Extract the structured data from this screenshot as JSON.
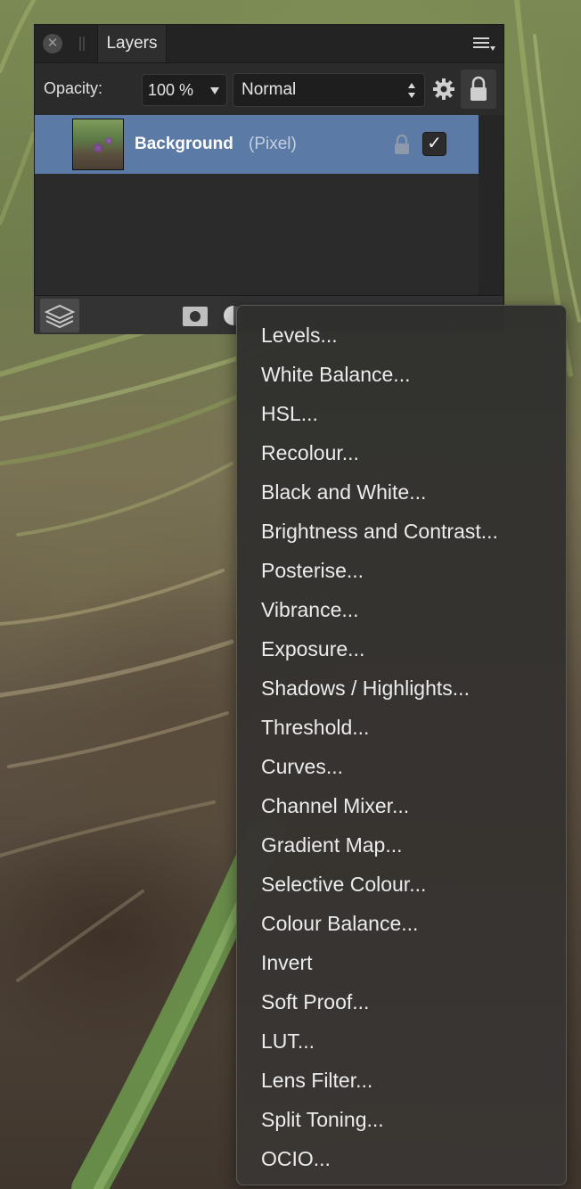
{
  "layers_panel": {
    "tab_label": "Layers",
    "opacity_label": "Opacity:",
    "opacity_value": "100 %",
    "blend_mode": "Normal",
    "icons": {
      "close": "close-icon",
      "menu": "panel-menu-icon",
      "settings": "gear-icon",
      "lock": "lock-icon"
    },
    "layers": [
      {
        "name": "Background",
        "type": "(Pixel)",
        "visible": true,
        "locked": true
      }
    ],
    "footer_icons": [
      "layers-stack-icon",
      "mask-icon",
      "adjustment-icon"
    ]
  },
  "adjustment_menu": {
    "items": [
      "Levels...",
      "White Balance...",
      "HSL...",
      "Recolour...",
      "Black and White...",
      "Brightness and Contrast...",
      "Posterise...",
      "Vibrance...",
      "Exposure...",
      "Shadows / Highlights...",
      "Threshold...",
      "Curves...",
      "Channel Mixer...",
      "Gradient Map...",
      "Selective Colour...",
      "Colour Balance...",
      "Invert",
      "Soft Proof...",
      "LUT...",
      "Lens Filter...",
      "Split Toning...",
      "OCIO..."
    ]
  },
  "colors": {
    "selected_row": "#5b7aa6",
    "panel_bg": "#2b2b2b",
    "menu_text": "#ececec"
  }
}
